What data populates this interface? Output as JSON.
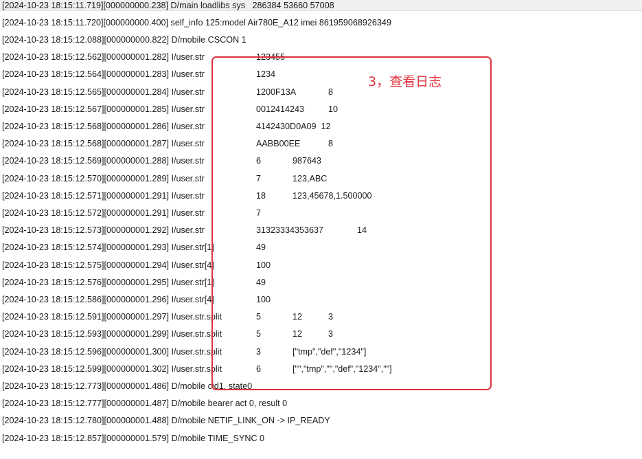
{
  "annotation": {
    "text": "3，查看日志",
    "color": "#e0313d"
  },
  "log": {
    "lines": [
      {
        "prefix": "[2024-10-23 18:15:11.719][000000000.238] D/main loadlibs sys   286384 53660 57008",
        "c1": "",
        "c2": "",
        "c3": ""
      },
      {
        "prefix": "[2024-10-23 18:15:11.720][000000000.400] self_info 125:model Air780E_A12 imei 861959068926349",
        "c1": "",
        "c2": "",
        "c3": ""
      },
      {
        "prefix": "[2024-10-23 18:15:12.088][000000000.822] D/mobile CSCON 1",
        "c1": "",
        "c2": "",
        "c3": ""
      },
      {
        "prefix": "[2024-10-23 18:15:12.562][000000001.282] I/user.str",
        "c1": "123455",
        "c2": "",
        "c3": ""
      },
      {
        "prefix": "[2024-10-23 18:15:12.564][000000001.283] I/user.str",
        "c1": "1234",
        "c2": "",
        "c3": ""
      },
      {
        "prefix": "[2024-10-23 18:15:12.565][000000001.284] I/user.str",
        "c1": "1200F13A",
        "c2": "",
        "c3": "8"
      },
      {
        "prefix": "[2024-10-23 18:15:12.567][000000001.285] I/user.str",
        "c1": "0012414243",
        "c2": "",
        "c3": "10"
      },
      {
        "prefix": "[2024-10-23 18:15:12.568][000000001.286] I/user.str",
        "c1": "4142430D0A09  12",
        "c2": "",
        "c3": ""
      },
      {
        "prefix": "[2024-10-23 18:15:12.568][000000001.287] I/user.str",
        "c1": "AABB00EE",
        "c2": "",
        "c3": "8"
      },
      {
        "prefix": "[2024-10-23 18:15:12.569][000000001.288] I/user.str",
        "c1": "6",
        "c2": "987643",
        "c3": ""
      },
      {
        "prefix": "[2024-10-23 18:15:12.570][000000001.289] I/user.str",
        "c1": "7",
        "c2": "123,ABC",
        "c3": ""
      },
      {
        "prefix": "[2024-10-23 18:15:12.571][000000001.291] I/user.str",
        "c1": "18",
        "c2": "123,45678,1.500000",
        "c3": ""
      },
      {
        "prefix": "[2024-10-23 18:15:12.572][000000001.291] I/user.str",
        "c1": "7",
        "c2": "",
        "c3": ""
      },
      {
        "prefix": "[2024-10-23 18:15:12.573][000000001.292] I/user.str",
        "c1": "31323334353637              14",
        "c2": "",
        "c3": ""
      },
      {
        "prefix": "[2024-10-23 18:15:12.574][000000001.293] I/user.str[1]",
        "c1": "49",
        "c2": "",
        "c3": ""
      },
      {
        "prefix": "[2024-10-23 18:15:12.575][000000001.294] I/user.str[4]",
        "c1": "100",
        "c2": "",
        "c3": ""
      },
      {
        "prefix": "[2024-10-23 18:15:12.576][000000001.295] I/user.str[1]",
        "c1": "49",
        "c2": "",
        "c3": ""
      },
      {
        "prefix": "[2024-10-23 18:15:12.586][000000001.296] I/user.str[4]",
        "c1": "100",
        "c2": "",
        "c3": ""
      },
      {
        "prefix": "[2024-10-23 18:15:12.591][000000001.297] I/user.str.split",
        "c1": "5",
        "c2": "12",
        "c3": "3"
      },
      {
        "prefix": "[2024-10-23 18:15:12.593][000000001.299] I/user.str.split",
        "c1": "5",
        "c2": "12",
        "c3": "3"
      },
      {
        "prefix": "[2024-10-23 18:15:12.596][000000001.300] I/user.str.split",
        "c1": "3",
        "c2": "[\"tmp\",\"def\",\"1234\"]",
        "c3": ""
      },
      {
        "prefix": "[2024-10-23 18:15:12.599][000000001.302] I/user.str.split",
        "c1": "6",
        "c2": "[\"\",\"tmp\",\"\",\"def\",\"1234\",\"\"]",
        "c3": ""
      },
      {
        "prefix": "[2024-10-23 18:15:12.773][000000001.486] D/mobile cid1, state0",
        "c1": "",
        "c2": "",
        "c3": ""
      },
      {
        "prefix": "[2024-10-23 18:15:12.777][000000001.487] D/mobile bearer act 0, result 0",
        "c1": "",
        "c2": "",
        "c3": ""
      },
      {
        "prefix": "[2024-10-23 18:15:12.780][000000001.488] D/mobile NETIF_LINK_ON -> IP_READY",
        "c1": "",
        "c2": "",
        "c3": ""
      },
      {
        "prefix": "[2024-10-23 18:15:12.857][000000001.579] D/mobile TIME_SYNC 0",
        "c1": "",
        "c2": "",
        "c3": ""
      }
    ]
  }
}
